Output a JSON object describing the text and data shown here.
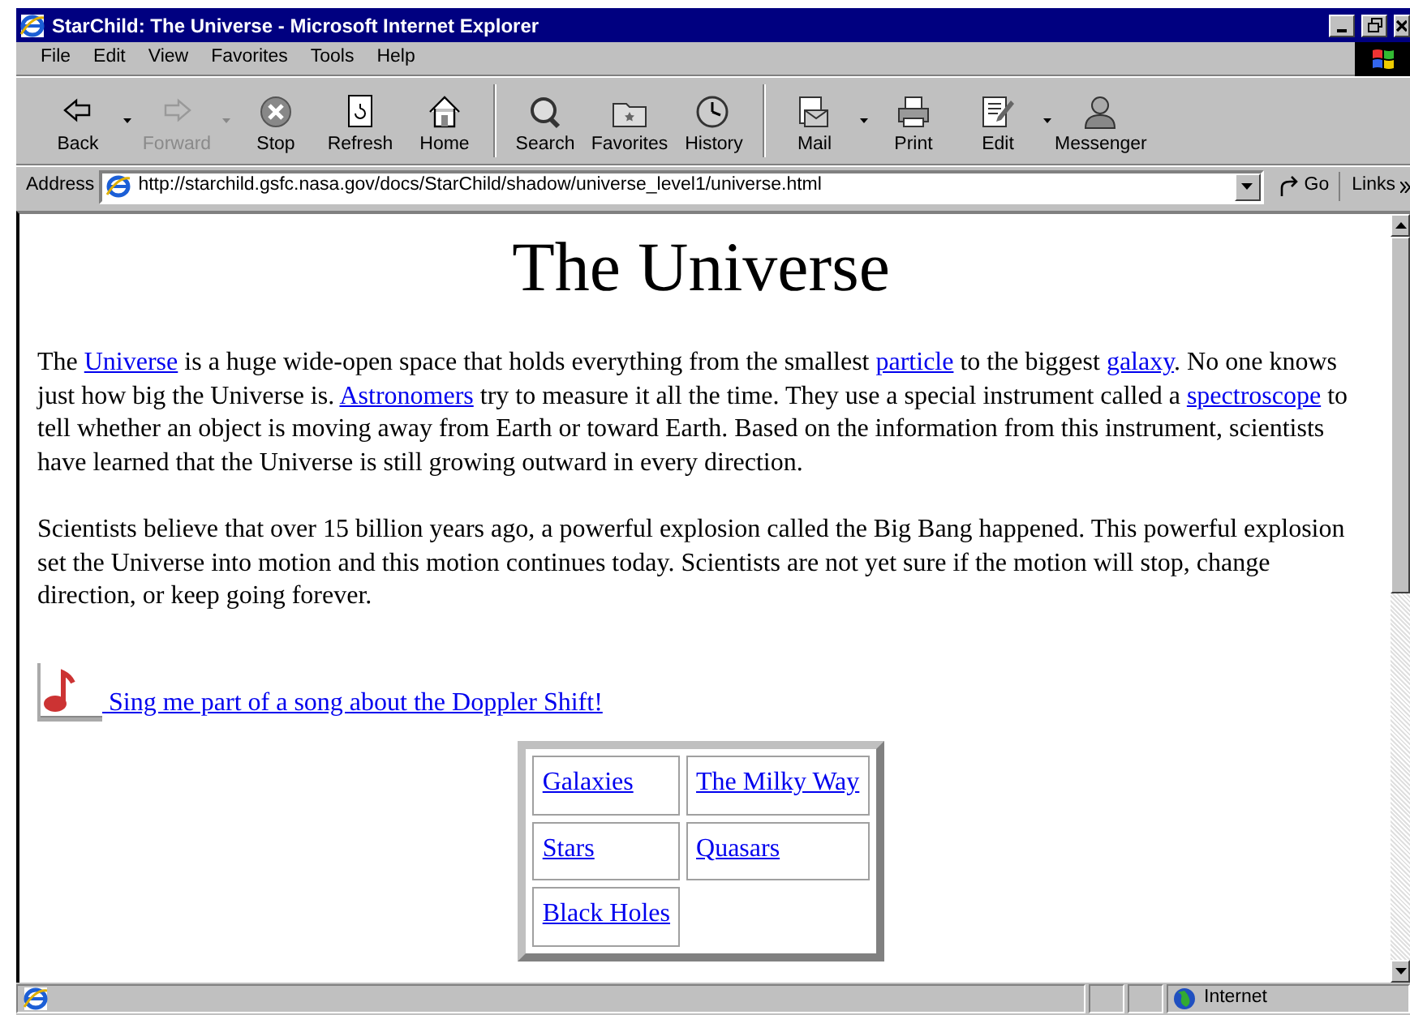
{
  "window": {
    "title": "StarChild: The Universe - Microsoft Internet Explorer"
  },
  "menu": [
    "File",
    "Edit",
    "View",
    "Favorites",
    "Tools",
    "Help"
  ],
  "toolbar": [
    [
      {
        "label": "Back",
        "dropdown": true,
        "disabled": false
      },
      {
        "label": "Forward",
        "dropdown": true,
        "disabled": true
      },
      {
        "label": "Stop",
        "dropdown": false,
        "disabled": false
      },
      {
        "label": "Refresh",
        "dropdown": false,
        "disabled": false
      },
      {
        "label": "Home",
        "dropdown": false,
        "disabled": false
      }
    ],
    [
      {
        "label": "Search",
        "dropdown": false,
        "disabled": false
      },
      {
        "label": "Favorites",
        "dropdown": false,
        "disabled": false
      },
      {
        "label": "History",
        "dropdown": false,
        "disabled": false
      }
    ],
    [
      {
        "label": "Mail",
        "dropdown": true,
        "disabled": false
      },
      {
        "label": "Print",
        "dropdown": false,
        "disabled": false
      },
      {
        "label": "Edit",
        "dropdown": true,
        "disabled": false
      },
      {
        "label": "Messenger",
        "dropdown": false,
        "disabled": false
      }
    ]
  ],
  "address_bar": {
    "label": "Address",
    "url": "http://starchild.gsfc.nasa.gov/docs/StarChild/shadow/universe_level1/universe.html",
    "go": "Go",
    "links": "Links"
  },
  "page": {
    "heading": "The Universe",
    "paragraphs": [
      [
        {
          "text": "The ",
          "kind": "text"
        },
        {
          "text": "Universe",
          "kind": "link"
        },
        {
          "text": " is a huge wide-open space that holds everything from the smallest ",
          "kind": "text"
        },
        {
          "text": "particle",
          "kind": "link"
        },
        {
          "text": " to the biggest ",
          "kind": "text"
        },
        {
          "text": "galaxy",
          "kind": "link"
        },
        {
          "text": ". No one knows just how big the Universe is. ",
          "kind": "text"
        },
        {
          "text": "Astronomers",
          "kind": "link"
        },
        {
          "text": " try to measure it all the time. They use a special instrument called a ",
          "kind": "text"
        },
        {
          "text": "spectroscope",
          "kind": "link"
        },
        {
          "text": " to tell whether an object is moving away from Earth or toward Earth. Based on the information from this instrument, scientists have learned that the Universe is still growing outward in every direction.",
          "kind": "text"
        }
      ],
      [
        {
          "text": "Scientists believe that over 15 billion years ago, a powerful explosion called the Big Bang happened. This powerful explosion set the Universe into motion and this motion continues today. Scientists are not yet sure if the motion will stop, change direction, or keep going forever.",
          "kind": "text"
        }
      ]
    ],
    "song_link": " Sing me part of a song about the Doppler Shift!",
    "topics": [
      [
        "Galaxies",
        "The Milky Way"
      ],
      [
        "Stars",
        "Quasars"
      ],
      [
        "Black Holes"
      ]
    ]
  },
  "status_bar": {
    "zone": "Internet"
  }
}
